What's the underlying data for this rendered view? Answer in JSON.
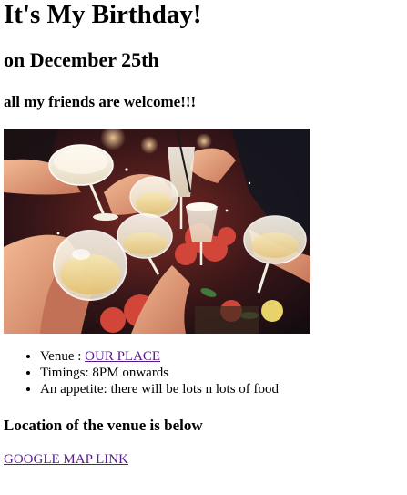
{
  "page": {
    "title": "It's My Birthday!",
    "date_heading": "on December 25th",
    "welcome_heading": "all my friends are welcome!!!"
  },
  "photo": {
    "icon": "party-toast-photo",
    "palette": {
      "background": "#2a0f12",
      "warm": "#d2463a",
      "skin": "#e9a27e",
      "glass": "#f4efe3",
      "drink": "#f1d98f",
      "dark": "#14161f"
    }
  },
  "details": {
    "venue_label": "Venue : ",
    "venue_link": "OUR PLACE",
    "timings": "Timings: 8PM onwards",
    "appetite": "An appetite: there will be lots n lots of food"
  },
  "location": {
    "heading": "Location of the venue is below",
    "map_link": "GOOGLE MAP LINK"
  },
  "colors": {
    "text": "#000000",
    "visited_link": "#551a8b",
    "background": "#ffffff"
  }
}
